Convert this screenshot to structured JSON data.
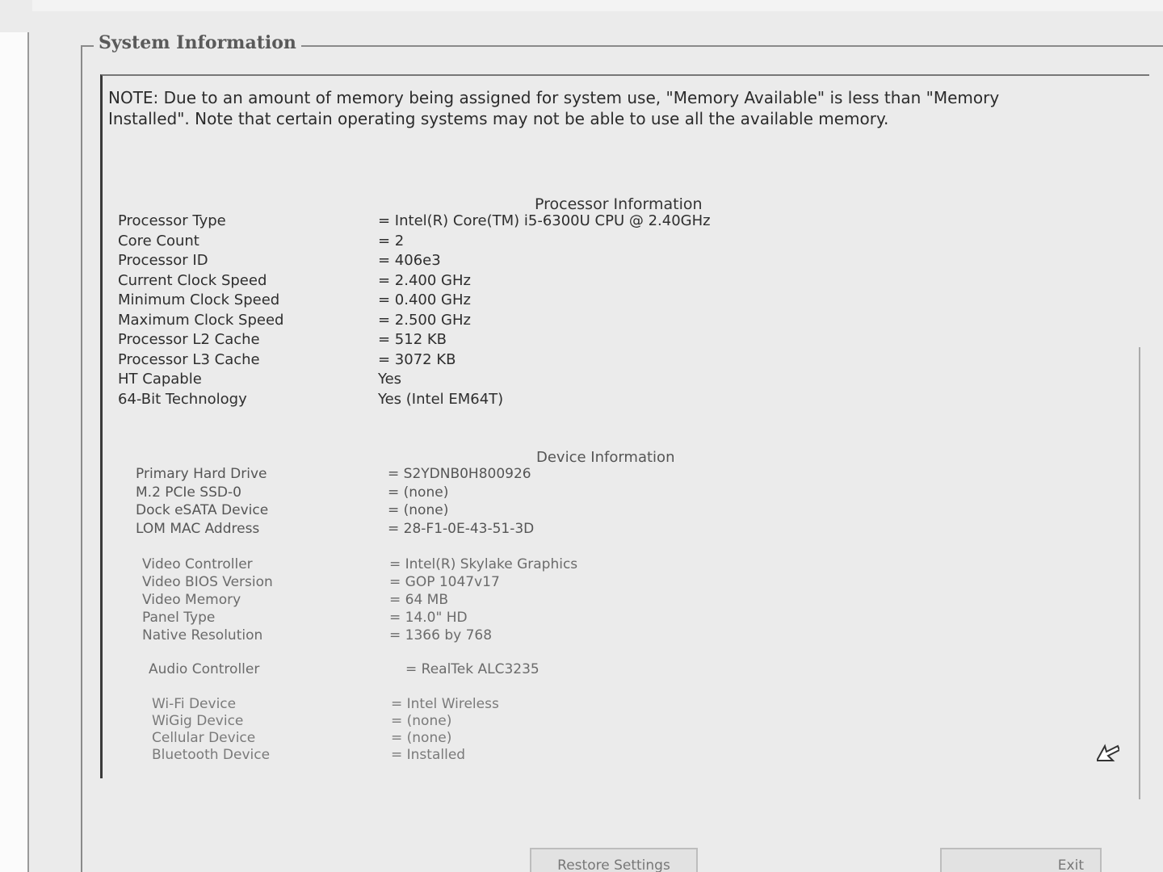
{
  "group": {
    "title": "System Information"
  },
  "note": "NOTE: Due to an amount of memory being assigned for system use, \"Memory Available\" is less than \"Memory Installed\". Note that certain operating systems may not be able to use all the available memory.",
  "processor": {
    "heading": "Processor Information",
    "rows": [
      {
        "label": "Processor Type",
        "value": "= Intel(R) Core(TM) i5-6300U CPU @ 2.40GHz"
      },
      {
        "label": "Core Count",
        "value": "= 2"
      },
      {
        "label": "Processor ID",
        "value": "= 406e3"
      },
      {
        "label": "Current Clock Speed",
        "value": "= 2.400 GHz"
      },
      {
        "label": "Minimum Clock Speed",
        "value": "= 0.400 GHz"
      },
      {
        "label": "Maximum Clock Speed",
        "value": "= 2.500 GHz"
      },
      {
        "label": "Processor L2 Cache",
        "value": "= 512 KB"
      },
      {
        "label": "Processor L3 Cache",
        "value": "= 3072 KB"
      },
      {
        "label": "HT Capable",
        "value": "Yes"
      },
      {
        "label": "64-Bit Technology",
        "value": "Yes (Intel EM64T)"
      }
    ]
  },
  "device": {
    "heading": "Device Information",
    "storage": [
      {
        "label": "Primary Hard Drive",
        "value": "= S2YDNB0H800926"
      },
      {
        "label": "M.2 PCIe SSD-0",
        "value": "= (none)"
      },
      {
        "label": "Dock eSATA Device",
        "value": "= (none)"
      },
      {
        "label": "LOM MAC Address",
        "value": "= 28-F1-0E-43-51-3D"
      }
    ],
    "video": [
      {
        "label": "Video Controller",
        "value": "= Intel(R) Skylake Graphics"
      },
      {
        "label": "Video BIOS Version",
        "value": "= GOP 1047v17"
      },
      {
        "label": "Video Memory",
        "value": "= 64 MB"
      },
      {
        "label": "Panel Type",
        "value": "= 14.0\" HD"
      },
      {
        "label": "Native Resolution",
        "value": "= 1366 by 768"
      }
    ],
    "audio": [
      {
        "label": "Audio Controller",
        "value": "= RealTek ALC3235"
      }
    ],
    "wireless": [
      {
        "label": "Wi-Fi Device",
        "value": "= Intel Wireless"
      },
      {
        "label": "WiGig Device",
        "value": "= (none)"
      },
      {
        "label": "Cellular Device",
        "value": "= (none)"
      },
      {
        "label": "Bluetooth Device",
        "value": "= Installed"
      }
    ]
  },
  "buttons": {
    "restore": "Restore Settings",
    "exit": "Exit"
  },
  "icons": {
    "cursor": "mouse-pointer-icon"
  }
}
